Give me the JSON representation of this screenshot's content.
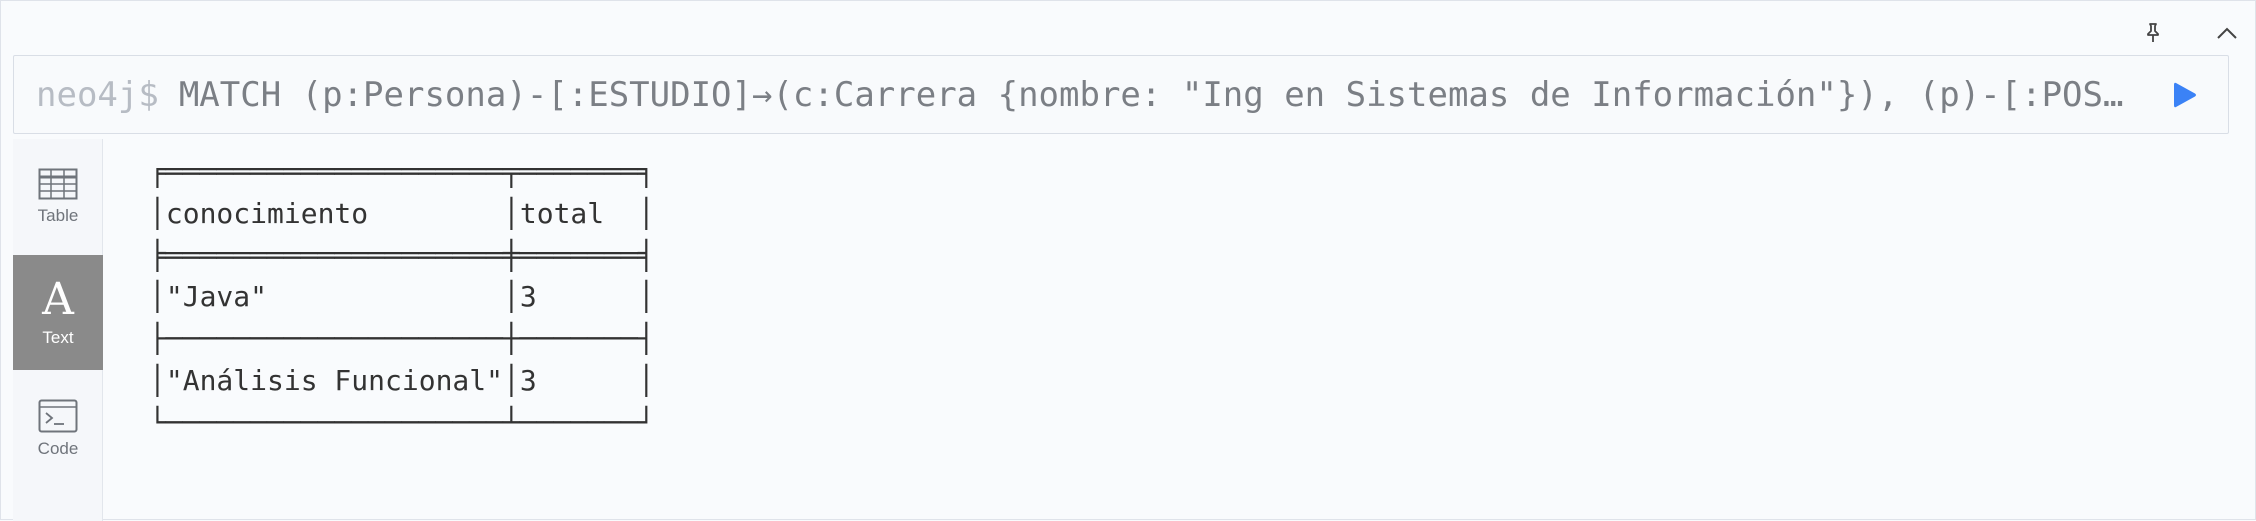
{
  "editor": {
    "prompt": "neo4j$",
    "query": "MATCH (p:Persona)-[:ESTUDIO]→(c:Carrera {nombre: \"Ing en Sistemas de Información\"}), (p)-[:POS…"
  },
  "sidebar": {
    "items": [
      {
        "label": "Table",
        "icon": "table-icon",
        "active": false
      },
      {
        "label": "Text",
        "icon": "text-icon",
        "active": true
      },
      {
        "label": "Code",
        "icon": "code-icon",
        "active": false
      }
    ],
    "text_glyph": "A"
  },
  "result": {
    "columns": [
      "conocimiento",
      "total"
    ],
    "rows": [
      [
        "\"Java\"",
        "3"
      ],
      [
        "\"Análisis Funcional\"",
        "3"
      ]
    ],
    "lines": [
      "╒════════════════════╤═══════╕",
      "│conocimiento        │total  │",
      "╞════════════════════╪═══════╡",
      "│\"Java\"              │3      │",
      "├────────────────────┼───────┤",
      "│\"Análisis Funcional\"│3      │",
      "└────────────────────┴───────┘"
    ]
  },
  "colors": {
    "run_button": "#3b82f6",
    "active_tab_bg": "#8a8a8a",
    "background": "#f9fbfd"
  }
}
